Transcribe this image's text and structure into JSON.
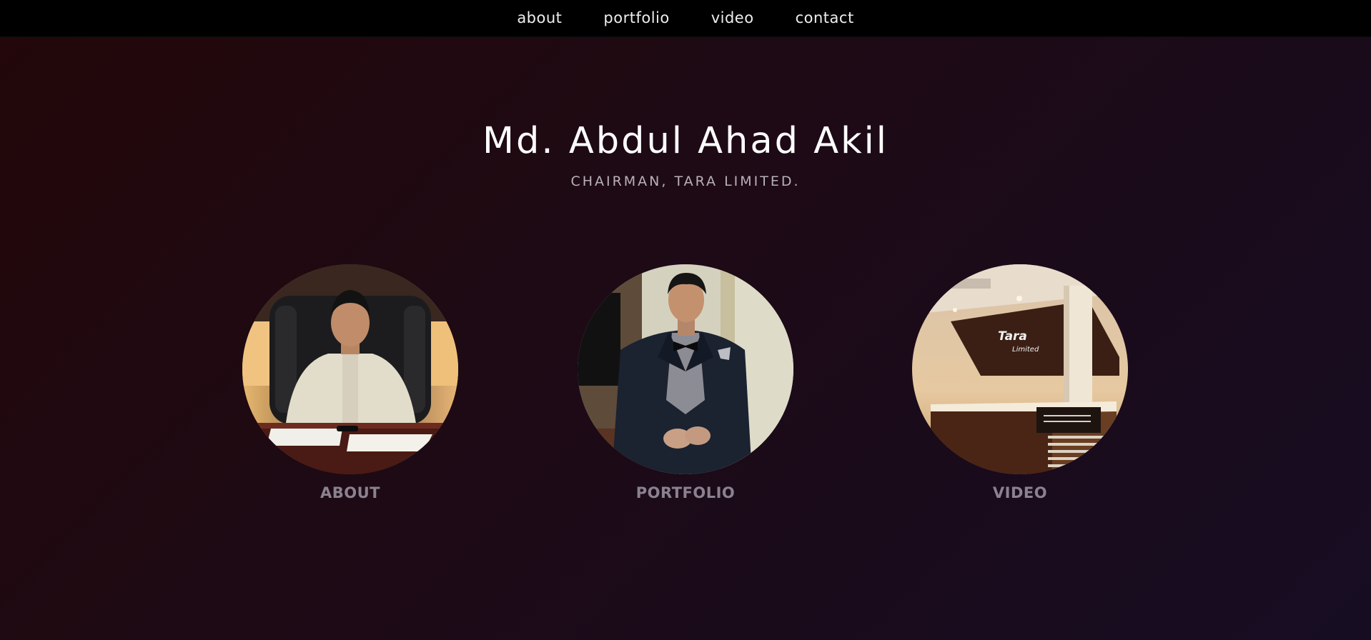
{
  "nav": {
    "items": [
      {
        "label": "about"
      },
      {
        "label": "portfolio"
      },
      {
        "label": "video"
      },
      {
        "label": "contact"
      }
    ]
  },
  "hero": {
    "title": "Md. Abdul Ahad Akil",
    "subtitle": "CHAIRMAN, TARA LIMITED."
  },
  "tiles": [
    {
      "label": "ABOUT",
      "image": "photo-seated-in-office-chair"
    },
    {
      "label": "PORTFOLIO",
      "image": "photo-standing-in-suit"
    },
    {
      "label": "VIDEO",
      "image": "photo-tara-limited-reception",
      "sign_text_1": "Tara",
      "sign_text_2": "Limited"
    }
  ],
  "colors": {
    "topbar": "#000000",
    "nav_text": "#eeeeee",
    "title": "#ffffff",
    "subtitle": "#b9b2b8",
    "tile_label": "#8b8290",
    "background_start": "#230709",
    "background_end": "#170d23"
  }
}
